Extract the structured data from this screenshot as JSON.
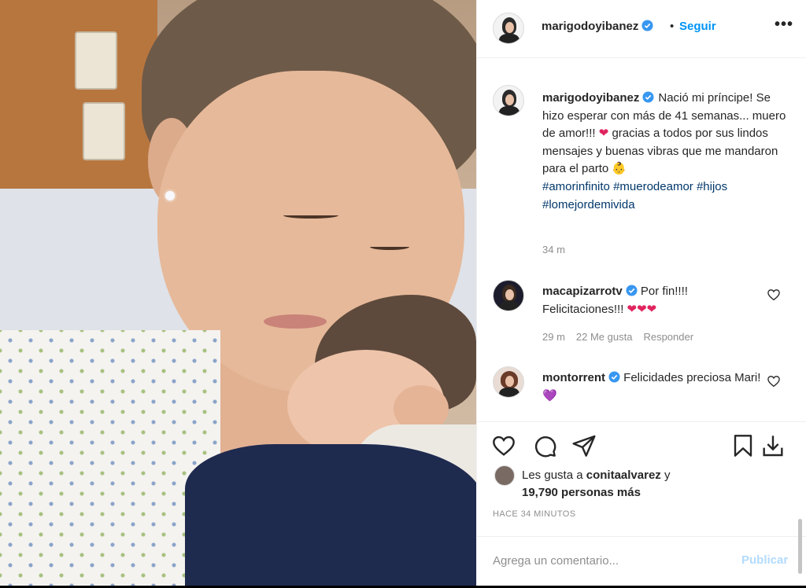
{
  "post": {
    "author": "marigodoyibanez",
    "follow_label": "Seguir",
    "dot": "•",
    "more_label": "•••"
  },
  "caption": {
    "author": "marigodoyibanez",
    "text_line1": "Nació mi príncipe! Se hizo esperar con más de 41 semanas... muero de amor!!! ",
    "heart": "❤",
    "text_line2": " gracias a todos por sus lindos mensajes y buenas vibras que me mandaron para el parto ",
    "baby_emoji": "👶",
    "hashtags": [
      "#amorinfinito",
      "#muerodeamor",
      "#hijos",
      "#lomejordemivida"
    ],
    "time": "34 m"
  },
  "comments": [
    {
      "author": "macapizarrotv",
      "text": "Por fin!!!! Felicitaciones!!! ",
      "emoji": "❤❤❤",
      "time": "29 m",
      "likes": "22 Me gusta",
      "reply_label": "Responder"
    },
    {
      "author": "montorrent",
      "text": "Felicidades preciosa Mari! ",
      "emoji": "💜"
    }
  ],
  "likes": {
    "prefix": "Les gusta a ",
    "user": "conitaalvarez",
    "joiner": " y",
    "count": "19,790 personas más"
  },
  "timestamp": "HACE 34 MINUTOS",
  "add_comment": {
    "placeholder": "Agrega un comentario...",
    "publish_label": "Publicar"
  },
  "colors": {
    "accent": "#0095f6",
    "verified": "#3897f0",
    "hashtag": "#00376b",
    "muted": "#8e8e8e"
  },
  "icons": [
    "verified-badge-icon",
    "more-options-icon",
    "heart-icon",
    "comment-icon",
    "share-icon",
    "bookmark-icon",
    "download-icon"
  ]
}
